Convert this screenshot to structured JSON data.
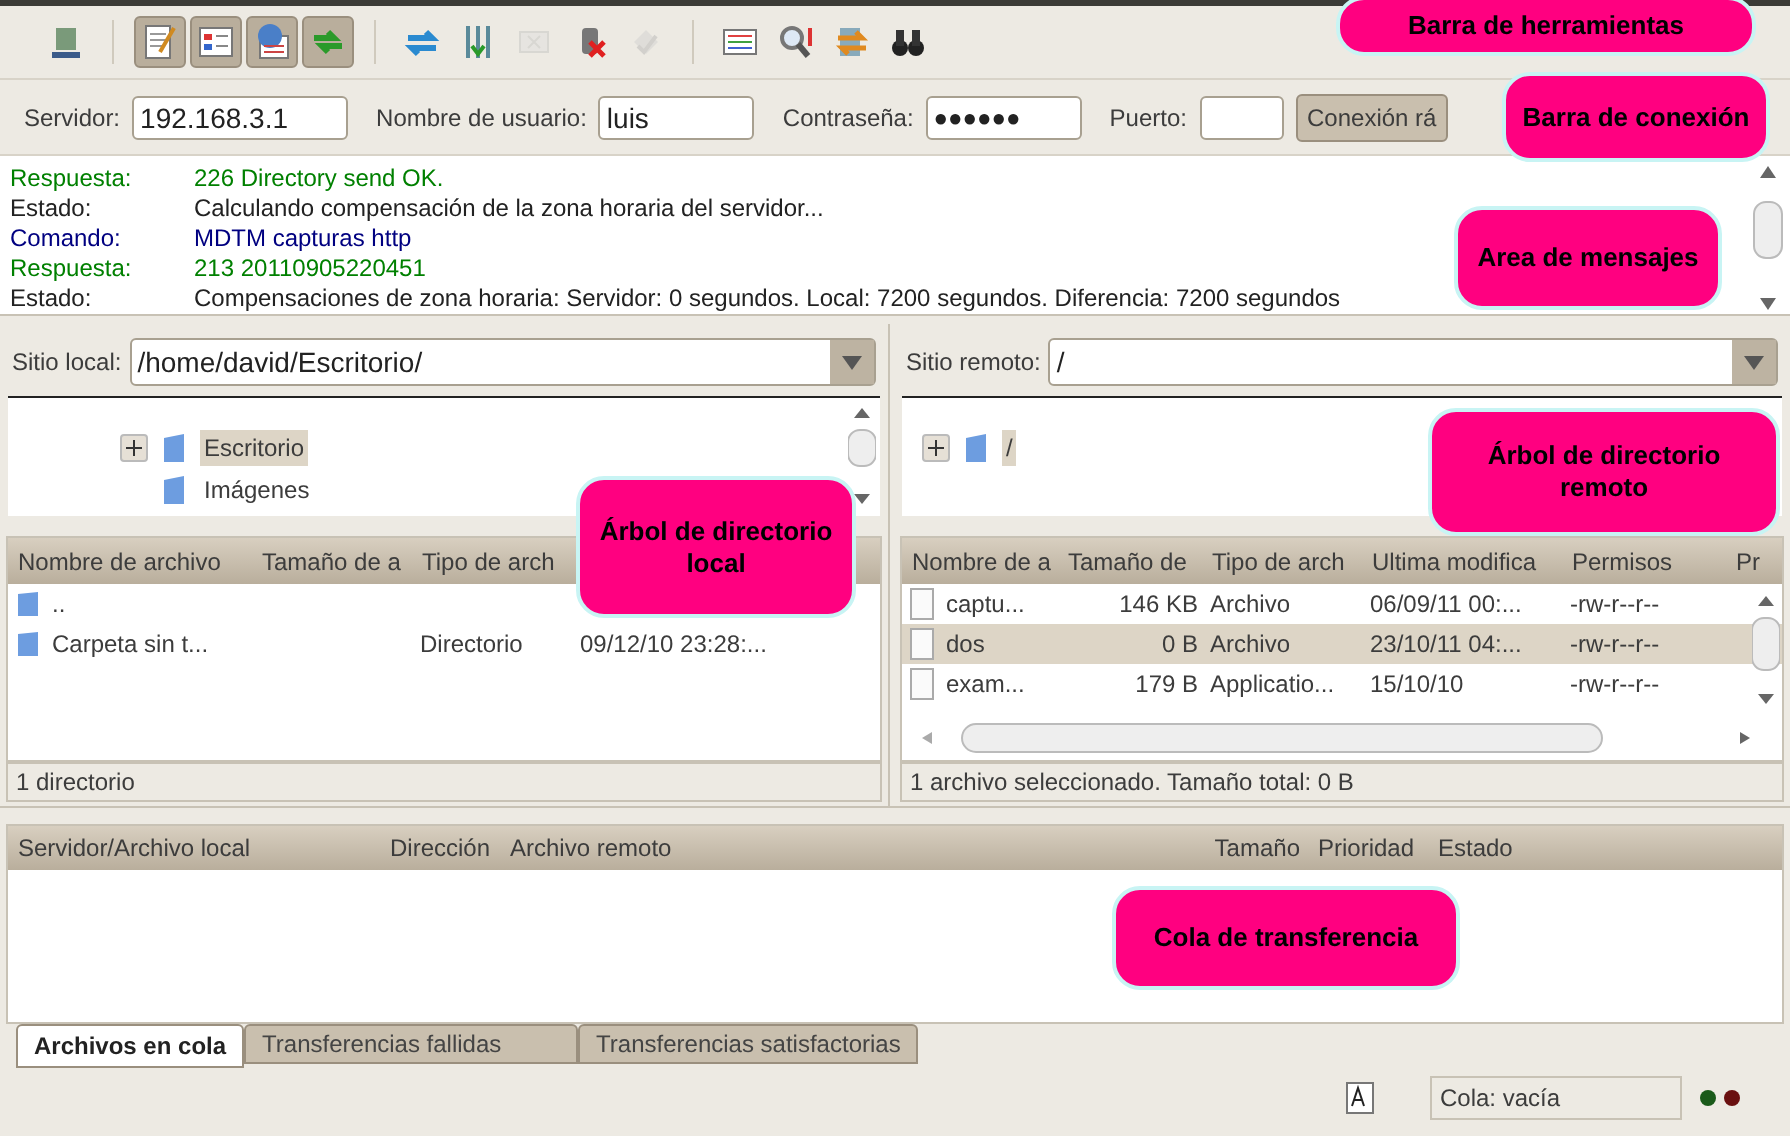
{
  "toolbar": [
    {
      "kind": "server",
      "pressed": false,
      "disabled": false
    },
    {
      "kind": "log",
      "pressed": true,
      "disabled": false
    },
    {
      "kind": "tree",
      "pressed": true,
      "disabled": false
    },
    {
      "kind": "remote",
      "pressed": true,
      "disabled": false
    },
    {
      "kind": "queue",
      "pressed": true,
      "disabled": false
    },
    {
      "kind": "refresh",
      "pressed": false,
      "disabled": false
    },
    {
      "kind": "filter",
      "pressed": false,
      "disabled": false
    },
    {
      "kind": "cancel",
      "pressed": false,
      "disabled": true
    },
    {
      "kind": "disconnect",
      "pressed": false,
      "disabled": false
    },
    {
      "kind": "reconnect",
      "pressed": false,
      "disabled": true
    },
    {
      "kind": "list",
      "pressed": false,
      "disabled": false
    },
    {
      "kind": "search",
      "pressed": false,
      "disabled": false
    },
    {
      "kind": "sync",
      "pressed": false,
      "disabled": false
    },
    {
      "kind": "find",
      "pressed": false,
      "disabled": false
    }
  ],
  "connection": {
    "host_label": "Servidor:",
    "host": "192.168.3.1",
    "user_label": "Nombre de usuario:",
    "user": "luis",
    "password_label": "Contraseña:",
    "password": "●●●●●●",
    "port_label": "Puerto:",
    "connect_button": "Conexión rá"
  },
  "messages": [
    {
      "kind": "response",
      "label": "Respuesta:",
      "text": "226 Directory send OK."
    },
    {
      "kind": "status",
      "label": "Estado:",
      "text": "Calculando compensación de la zona horaria del servidor..."
    },
    {
      "kind": "command",
      "label": "Comando:",
      "text": "MDTM capturas http"
    },
    {
      "kind": "response",
      "label": "Respuesta:",
      "text": "213 20110905220451"
    },
    {
      "kind": "status",
      "label": "Estado:",
      "text": "Compensaciones de zona horaria: Servidor: 0 segundos. Local: 7200 segundos. Diferencia: 7200 segundos"
    }
  ],
  "local": {
    "site_label": "Sitio local:",
    "path": "/home/david/Escritorio/",
    "tree": [
      {
        "label": "Escritorio",
        "selected": true,
        "expandable": true
      },
      {
        "label": "Imágenes",
        "selected": false,
        "expandable": false
      }
    ],
    "columns": [
      "Nombre de archivo",
      "Tamaño de a",
      "Tipo de arch",
      ""
    ],
    "rows": [
      {
        "kind": "folder",
        "selected": false,
        "cells": [
          "..",
          "",
          "",
          ""
        ]
      },
      {
        "kind": "folder",
        "selected": false,
        "cells": [
          "Carpeta sin t...",
          "",
          "Directorio",
          "09/12/10 23:28:..."
        ]
      }
    ],
    "status": "1 directorio"
  },
  "remote": {
    "site_label": "Sitio remoto:",
    "path": "/",
    "tree": [
      {
        "label": "/",
        "selected": true,
        "expandable": true
      }
    ],
    "columns": [
      "Nombre de a",
      "Tamaño de",
      "Tipo de arch",
      "Ultima modifica",
      "Permisos",
      "Pr"
    ],
    "rows": [
      {
        "kind": "file",
        "selected": false,
        "cells": [
          "captu...",
          "146 KB",
          "Archivo",
          "06/09/11 00:...",
          "-rw-r--r--",
          ""
        ]
      },
      {
        "kind": "file",
        "selected": true,
        "cells": [
          "dos",
          "0 B",
          "Archivo",
          "23/10/11 04:...",
          "-rw-r--r--",
          ""
        ]
      },
      {
        "kind": "file",
        "selected": false,
        "cells": [
          "exam...",
          "179 B",
          "Applicatio...",
          "15/10/10",
          "-rw-r--r--",
          ""
        ]
      }
    ],
    "status": "1 archivo seleccionado. Tamaño total: 0 B"
  },
  "queue": {
    "columns": [
      "Servidor/Archivo local",
      "Dirección",
      "Archivo remoto",
      "Tamaño",
      "Prioridad",
      "Estado"
    ],
    "tabs": [
      {
        "label": "Archivos en cola",
        "selected": true
      },
      {
        "label": "Transferencias fallidas",
        "selected": false
      },
      {
        "label": "Transferencias satisfactorias",
        "selected": false
      }
    ]
  },
  "status_bar": {
    "queue": "Cola: vacía"
  },
  "callouts": [
    "Barra de herramientas",
    "Barra de conexión",
    "Area de mensajes",
    "Árbol de directorio local",
    "Árbol de directorio remoto",
    "Cola de transferencia"
  ]
}
